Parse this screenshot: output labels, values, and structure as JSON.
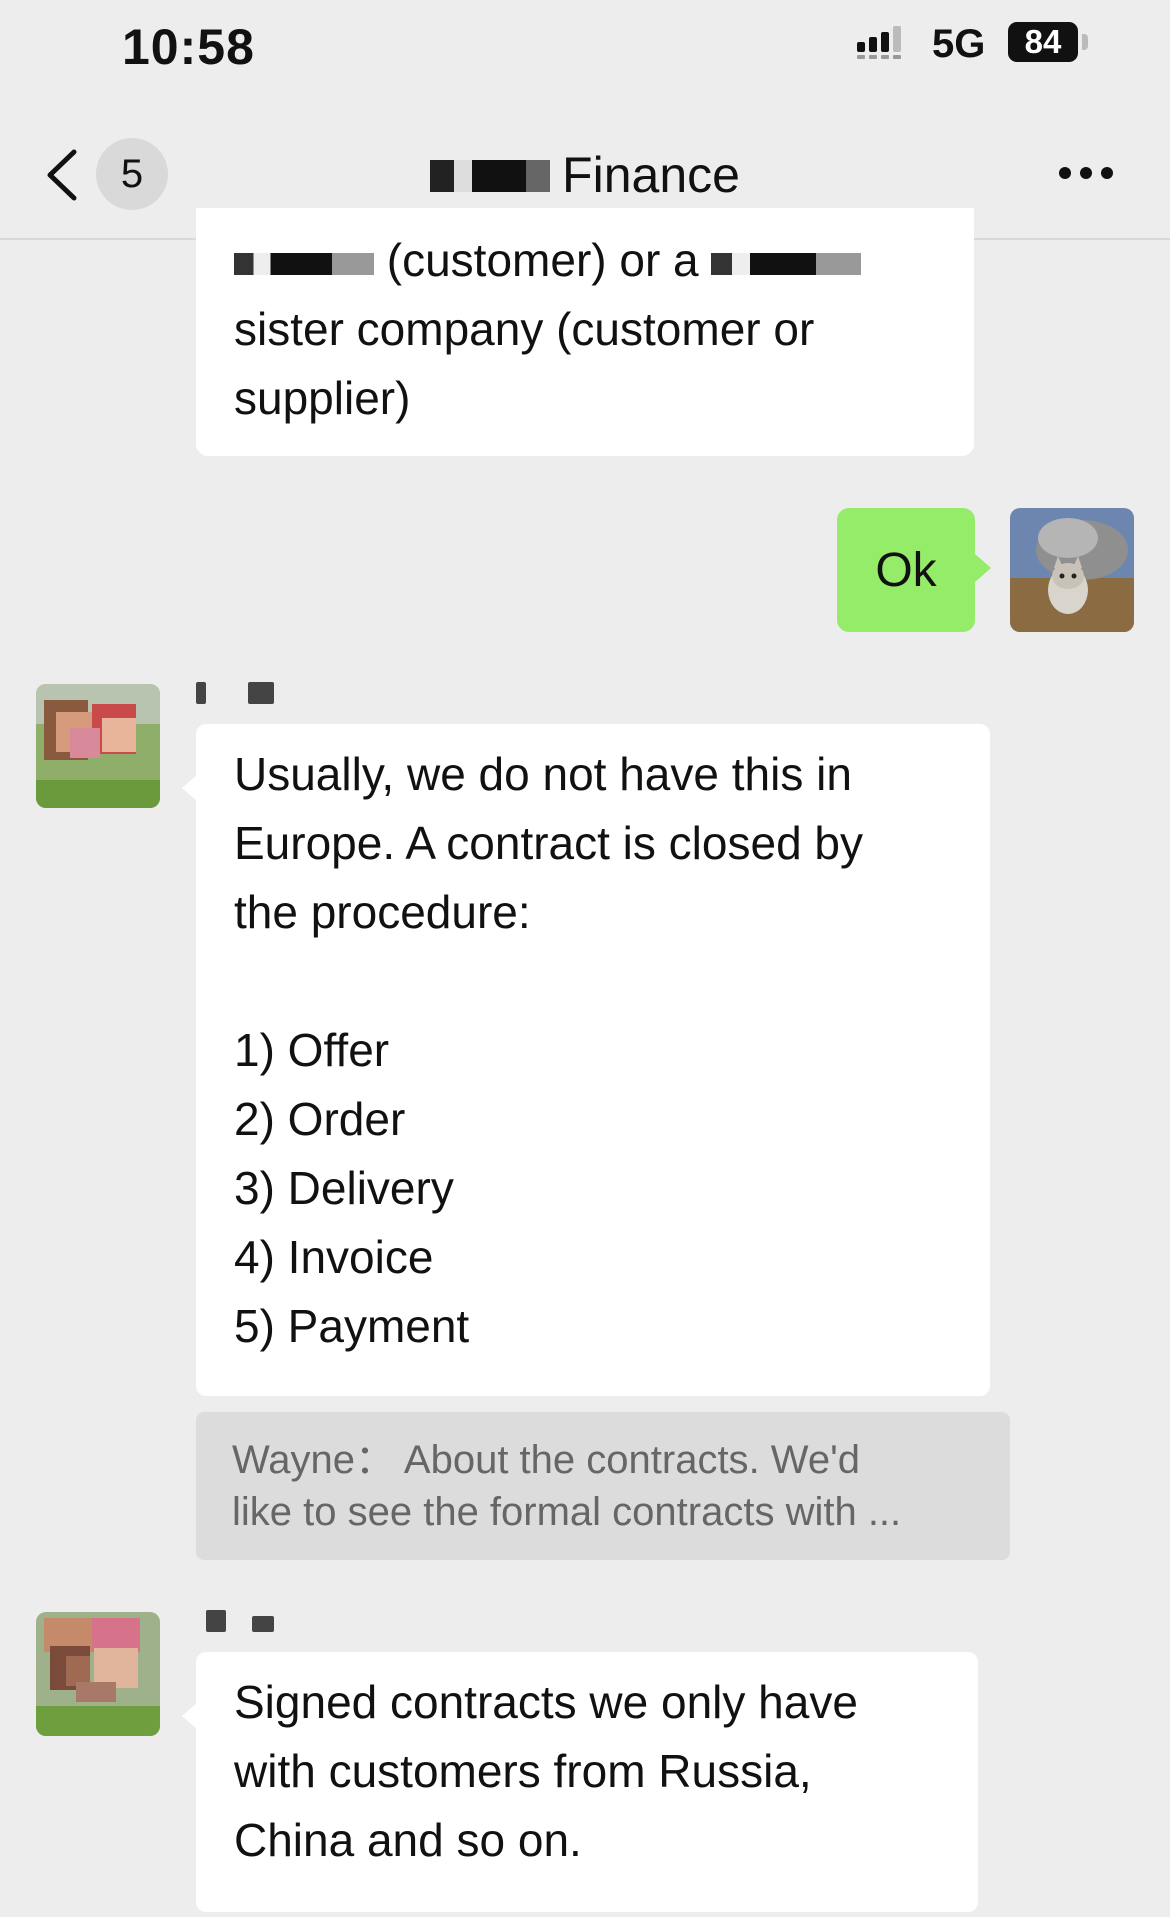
{
  "status_bar": {
    "time": "10:58",
    "network": "5G",
    "battery": "84",
    "icons": [
      "signal-icon",
      "battery-icon"
    ]
  },
  "nav": {
    "unread_count": "5",
    "title": "Finance",
    "icons": [
      "back-chevron-icon",
      "more-dots-icon"
    ]
  },
  "messages": [
    {
      "from": "other",
      "lines": [
        "(customer) or a",
        "sister company (customer or",
        "supplier)"
      ]
    },
    {
      "from": "self",
      "text": "Ok"
    },
    {
      "from": "other",
      "lines": [
        "Usually, we do not have this in",
        "Europe. A contract is closed by",
        "the procedure:",
        "",
        "1) Offer",
        "2) Order",
        "3) Delivery",
        "4) Invoice",
        "5) Payment"
      ],
      "quote": {
        "line1": "Wayne： About the contracts. We'd",
        "line2": "like to see the formal contracts with ..."
      }
    },
    {
      "from": "other",
      "lines": [
        "Signed contracts we only have",
        "with customers from Russia,",
        "China and so on."
      ]
    }
  ],
  "colors": {
    "background": "#ededed",
    "self_bubble": "#95ec69",
    "other_bubble": "#ffffff",
    "quote_bg": "#dcdcdc"
  }
}
